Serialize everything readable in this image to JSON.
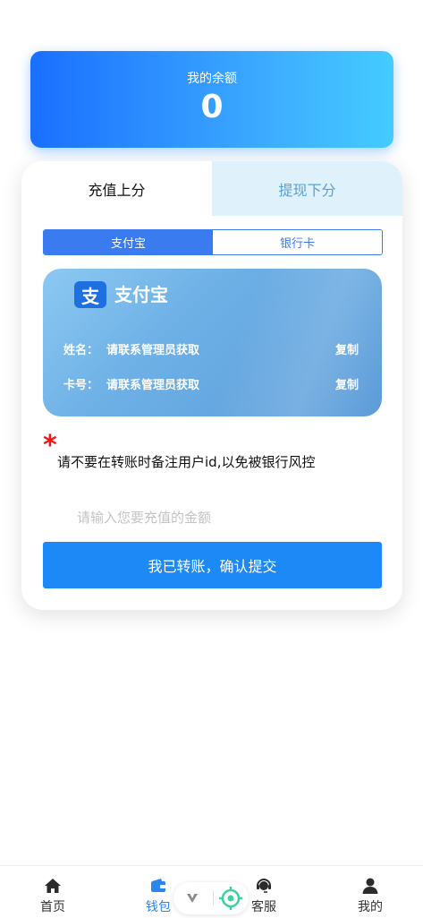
{
  "balance": {
    "label": "我的余额",
    "value": "0"
  },
  "tabs": [
    {
      "label": "充值上分",
      "active": true
    },
    {
      "label": "提现下分",
      "active": false
    }
  ],
  "payment_methods": [
    {
      "label": "支付宝",
      "active": true
    },
    {
      "label": "银行卡",
      "active": false
    }
  ],
  "account_card": {
    "logo_char": "支",
    "title": "支付宝",
    "name_label": "姓名：",
    "name_value": "请联系管理员获取",
    "card_label": "卡号：",
    "card_value": "请联系管理员获取",
    "copy_label": "复制"
  },
  "notice": {
    "star": "*",
    "text": "请不要在转账时备注用户id,以免被银行风控"
  },
  "amount_input": {
    "placeholder": "请输入您要充值的金额",
    "value": ""
  },
  "submit_button": {
    "label": "我已转账，确认提交"
  },
  "tabbar": [
    {
      "label": "首页",
      "icon": "home-icon",
      "active": false
    },
    {
      "label": "钱包",
      "icon": "wallet-icon",
      "active": true
    },
    {
      "label": "客服",
      "icon": "customer-service-icon",
      "active": false
    },
    {
      "label": "我的",
      "icon": "user-icon",
      "active": false
    }
  ],
  "colors": {
    "accent": "#1c89f6",
    "tab_active_text": "#2b87ee",
    "notice_star": "#f01818",
    "floating_target": "#3fd0a0"
  }
}
